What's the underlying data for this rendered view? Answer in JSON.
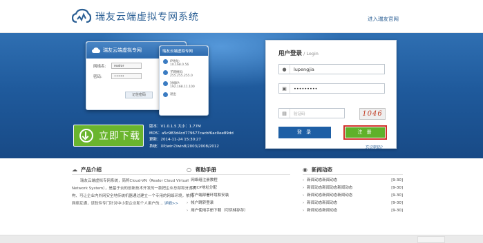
{
  "header": {
    "title": "瑞友云端虚拟专网系统",
    "enter_link": "进入瑞友官网"
  },
  "preview_big": {
    "title": "瑞友云端虚拟专网",
    "rows": [
      {
        "label": "网络名:",
        "value": "realor"
      },
      {
        "label": "密码:",
        "value": "•••••"
      }
    ],
    "button": "记住密码"
  },
  "preview_small": {
    "title": "瑞友云端虚拟专网",
    "rows": [
      {
        "a": "IP地址:",
        "b": "10.168.0.56"
      },
      {
        "a": "子网掩码:",
        "b": "255.255.255.0"
      },
      {
        "a": "对端IP:",
        "b": "192.168.11.100"
      }
    ],
    "footer": "退出"
  },
  "download": {
    "label": "立即下载",
    "icon": "download-arrow-icon"
  },
  "version_info": {
    "version": "版本：V1.0.1.5  大小：1.77M",
    "md5": "MD5：a5c983d4cd779677cacbf6ac0ee89dd",
    "updated": "更新：2014-11-24 15:30:27",
    "system": "系统：XP/win7/win8/2003/2008/2012"
  },
  "login": {
    "title": "用户登录",
    "title_en": " / Login",
    "username": "lupengjia",
    "password": "•••••••••",
    "captcha_placeholder": "验证码",
    "captcha_image": "1046",
    "login_button": "登 录",
    "register_button": "注 册",
    "forgot": "忘记密码？"
  },
  "product": {
    "heading": "产品介绍",
    "text": "瑞友云端虚拟专网系统，简称Cloud-VN（Realor Cloud Virtual Network System），是基于云的创新技术开发的一款把企业总部和分支机构、可让企业内外网安全地传统机器通过建立一个专用的网络环境，依托网络互通，该软件专门针对中小型企业和个人用户的…",
    "more": "详细>>"
  },
  "manual": {
    "heading": "帮助手册",
    "items": [
      "网络组注册教程",
      "DHCP地址分配",
      "客户端部署环境和安装",
      "帐户跳转登录",
      "用户使用手册下载（可供储存存）"
    ]
  },
  "news": {
    "heading": "新闻动态",
    "items": [
      {
        "title": "新闻动态新闻动态",
        "date": "[9-30]"
      },
      {
        "title": "新闻动态新闻动态新闻动态",
        "date": "[9-30]"
      },
      {
        "title": "新闻动态新闻动态新闻动态",
        "date": "[9-30]"
      },
      {
        "title": "新闻动态新闻动态",
        "date": "[9-30]"
      },
      {
        "title": "新闻动态新闻动态",
        "date": "[9-30]"
      }
    ]
  },
  "colors": {
    "brand": "#2b5f94",
    "hero": "#1f5a9c",
    "green": "#6ab52e",
    "highlight": "#d0302a"
  }
}
